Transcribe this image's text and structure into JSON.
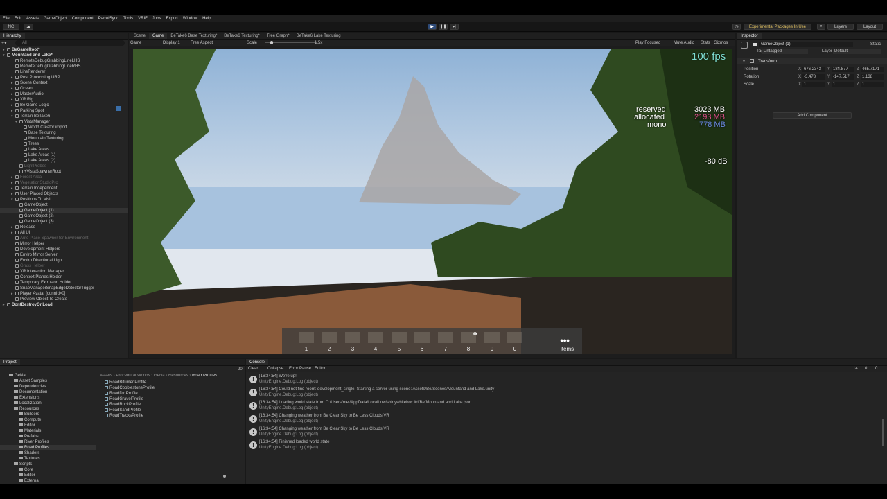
{
  "menu": [
    "File",
    "Edit",
    "Assets",
    "GameObject",
    "Component",
    "ParrelSync",
    "Tools",
    "VRIF",
    "Jobs",
    "Export",
    "Window",
    "Help"
  ],
  "toolbar": {
    "account": "NC",
    "packages": "Experimental Packages In Use",
    "layers": "Layers",
    "layout": "Layout"
  },
  "hierarchy": {
    "title": "Hierarchy",
    "search_placeholder": "All",
    "rows": [
      {
        "label": "BeGameRoot*",
        "indent": 0,
        "style": "bold",
        "arrow": "▾"
      },
      {
        "label": "Mountand and Lake*",
        "indent": 0,
        "style": "bold",
        "arrow": "▾"
      },
      {
        "label": "RemoteDebugGrabbingLineLHS",
        "indent": 2,
        "style": ""
      },
      {
        "label": "RemoteDebugGrabbingLineRHS",
        "indent": 2,
        "style": ""
      },
      {
        "label": "LineRenderer",
        "indent": 2,
        "style": ""
      },
      {
        "label": "Post Processing URP",
        "indent": 2,
        "style": "",
        "arrow": "▸"
      },
      {
        "label": "Scene Context",
        "indent": 2,
        "style": "",
        "arrow": "▸"
      },
      {
        "label": "Ocean",
        "indent": 2,
        "style": "",
        "arrow": "▸"
      },
      {
        "label": "MasterAudio",
        "indent": 2,
        "style": "",
        "arrow": "▸"
      },
      {
        "label": "XR Rig",
        "indent": 2,
        "style": "",
        "arrow": "▸"
      },
      {
        "label": "Be Game Logic",
        "indent": 2,
        "style": "",
        "arrow": "▸"
      },
      {
        "label": "Parking Spot",
        "indent": 2,
        "style": "",
        "arrow": "▸"
      },
      {
        "label": "Terrain BeTake6",
        "indent": 2,
        "style": "",
        "arrow": "▾"
      },
      {
        "label": "VistaManager",
        "indent": 3,
        "style": "",
        "arrow": "▾"
      },
      {
        "label": "World Creator import",
        "indent": 4,
        "style": ""
      },
      {
        "label": "Base Texturing",
        "indent": 4,
        "style": ""
      },
      {
        "label": "Mountain Texturing",
        "indent": 4,
        "style": ""
      },
      {
        "label": "Trees",
        "indent": 4,
        "style": ""
      },
      {
        "label": "Lake Areas",
        "indent": 4,
        "style": ""
      },
      {
        "label": "Lake Areas (1)",
        "indent": 4,
        "style": ""
      },
      {
        "label": "Lake Areas (2)",
        "indent": 4,
        "style": ""
      },
      {
        "label": "LightProbes",
        "indent": 3,
        "style": "dim"
      },
      {
        "label": "+VistaSpawnerRoot",
        "indent": 3,
        "style": ""
      },
      {
        "label": "Forest Area",
        "indent": 2,
        "style": "dim",
        "arrow": "▸"
      },
      {
        "label": "VegetationStudioPro",
        "indent": 2,
        "style": "dim",
        "arrow": "▸"
      },
      {
        "label": "Terrain Independent",
        "indent": 2,
        "style": "",
        "arrow": "▸"
      },
      {
        "label": "User Placed Objects",
        "indent": 2,
        "style": "",
        "arrow": "▸"
      },
      {
        "label": "Positions To Visit",
        "indent": 2,
        "style": "",
        "arrow": "▾"
      },
      {
        "label": "GameObject",
        "indent": 3,
        "style": ""
      },
      {
        "label": "GameObject (1)",
        "indent": 3,
        "style": "sel"
      },
      {
        "label": "GameObject (2)",
        "indent": 3,
        "style": ""
      },
      {
        "label": "GameObject (3)",
        "indent": 3,
        "style": ""
      },
      {
        "label": "Release",
        "indent": 2,
        "style": "",
        "arrow": "▸"
      },
      {
        "label": "All UI",
        "indent": 2,
        "style": "",
        "arrow": "▸"
      },
      {
        "label": "Auto Place Spawner for Environment",
        "indent": 2,
        "style": "dim"
      },
      {
        "label": "Mirror Helper",
        "indent": 2,
        "style": ""
      },
      {
        "label": "Development Helpers",
        "indent": 2,
        "style": ""
      },
      {
        "label": "Enviro Mirror Server",
        "indent": 2,
        "style": ""
      },
      {
        "label": "Enviro Directional Light",
        "indent": 2,
        "style": ""
      },
      {
        "label": "Grass Helper",
        "indent": 2,
        "style": "dim"
      },
      {
        "label": "XR Interaction Manager",
        "indent": 2,
        "style": ""
      },
      {
        "label": "Context Planes Holder",
        "indent": 2,
        "style": ""
      },
      {
        "label": "Temporary Extrusion Holder",
        "indent": 2,
        "style": ""
      },
      {
        "label": "SnapManagerSnapEdgeDetectorTrigger",
        "indent": 2,
        "style": ""
      },
      {
        "label": "Player Avatar [connId=0]",
        "indent": 2,
        "style": "",
        "arrow": "▸"
      },
      {
        "label": "Preview Object To Create",
        "indent": 2,
        "style": ""
      },
      {
        "label": "DontDestroyOnLoad",
        "indent": 0,
        "style": "bold",
        "arrow": "▸"
      }
    ]
  },
  "scene_tabs": [
    {
      "label": "Scene",
      "active": false
    },
    {
      "label": "Game",
      "active": true
    },
    {
      "label": "BeTake6 Base Texturing*",
      "active": false
    },
    {
      "label": "BeTake6 Texturing*",
      "active": false
    },
    {
      "label": "Tree Graph*",
      "active": false
    },
    {
      "label": "BeTake6 Lake Texturing",
      "active": false
    }
  ],
  "game_bar": {
    "mode": "Game",
    "display": "Display 1",
    "aspect": "Free Aspect",
    "scale_label": "Scale",
    "scale_value": "1.5x",
    "play_focused": "Play Focused",
    "mute": "Mute Audio",
    "stats": "Stats",
    "gizmos": "Gizmos"
  },
  "hud": {
    "fps": "100 fps",
    "reserved_label": "reserved",
    "reserved_value": "3023 MB",
    "allocated_label": "allocated",
    "allocated_value": "2193 MB",
    "mono_label": "mono",
    "mono_value": "778 MB",
    "db": "-80 dB",
    "slots": [
      "1",
      "2",
      "3",
      "4",
      "5",
      "6",
      "7",
      "8",
      "9",
      "0"
    ],
    "items": "items",
    "colors": {
      "allocated": "#e0508a",
      "mono": "#6a8ae0"
    }
  },
  "inspector": {
    "title": "Inspector",
    "object_name": "GameObject (1)",
    "static_label": "Static",
    "tag_label": "Tag",
    "tag_value": "Untagged",
    "layer_label": "Layer",
    "layer_value": "Default",
    "component": "Transform",
    "position": {
      "label": "Position",
      "x": "676.2343",
      "y": "184.877",
      "z": "465.7171"
    },
    "rotation": {
      "label": "Rotation",
      "x": "-3.478",
      "y": "-147.517",
      "z": "1.138"
    },
    "scale": {
      "label": "Scale",
      "x": "1",
      "y": "1",
      "z": "1"
    },
    "add_component": "Add Component"
  },
  "project": {
    "title": "Project",
    "tree": [
      {
        "label": "GeNa",
        "indent": 1
      },
      {
        "label": "Asset Samples",
        "indent": 2
      },
      {
        "label": "Dependencies",
        "indent": 2
      },
      {
        "label": "Documentation",
        "indent": 2
      },
      {
        "label": "Extensions",
        "indent": 2
      },
      {
        "label": "Localization",
        "indent": 2
      },
      {
        "label": "Resources",
        "indent": 2
      },
      {
        "label": "Builders",
        "indent": 3
      },
      {
        "label": "Compute",
        "indent": 3
      },
      {
        "label": "Editor",
        "indent": 3
      },
      {
        "label": "Materials",
        "indent": 3
      },
      {
        "label": "Prefabs",
        "indent": 3
      },
      {
        "label": "River Profiles",
        "indent": 3
      },
      {
        "label": "Road Profiles",
        "indent": 3,
        "selected": true
      },
      {
        "label": "Shaders",
        "indent": 3
      },
      {
        "label": "Textures",
        "indent": 3
      },
      {
        "label": "Scripts",
        "indent": 2
      },
      {
        "label": "Core",
        "indent": 3
      },
      {
        "label": "Editor",
        "indent": 3
      },
      {
        "label": "External",
        "indent": 3
      }
    ],
    "breadcrumb": [
      "Assets",
      "Procedural Worlds",
      "GeNa",
      "Resources",
      "Road Profiles"
    ],
    "files": [
      "RoadBitumenProfile",
      "RoadCobblestoneProfile",
      "RoadDirtProfile",
      "RoadGravelProfile",
      "RoadRockProfile",
      "RoadSandProfile",
      "RoadTracksProfile"
    ],
    "count": "20"
  },
  "console": {
    "title": "Console",
    "clear": "Clear",
    "collapse": "Collapse",
    "error_pause": "Error Pause",
    "editor": "Editor",
    "info_count": "14",
    "warn_count": "0",
    "err_count": "0",
    "entries": [
      {
        "l1": "[16:34:54] We're up!",
        "l2": "UnityEngine.Debug:Log (object)"
      },
      {
        "l1": "[16:34:54] Could not find room: development_single. Starting a server using scene: Assets/Be/Scenes/Mountand and Lake.unity",
        "l2": "UnityEngine.Debug:Log (object)"
      },
      {
        "l1": "[16:34:54] Loading world state from C:/Users/mel/AppData/LocalLow/shinywhitebox ltd/Be/Mountand and Lake.json",
        "l2": "UnityEngine.Debug:Log (object)"
      },
      {
        "l1": "[16:34:54] Changing weather from Be Clear Sky to Be Less Clouds VR",
        "l2": "UnityEngine.Debug:Log (object)"
      },
      {
        "l1": "[16:34:54] Changing weather from Be Clear Sky to Be Less Clouds VR",
        "l2": "UnityEngine.Debug:Log (object)"
      },
      {
        "l1": "[16:34:54] Finished loaded world state",
        "l2": "UnityEngine.Debug:Log (object)"
      }
    ]
  }
}
